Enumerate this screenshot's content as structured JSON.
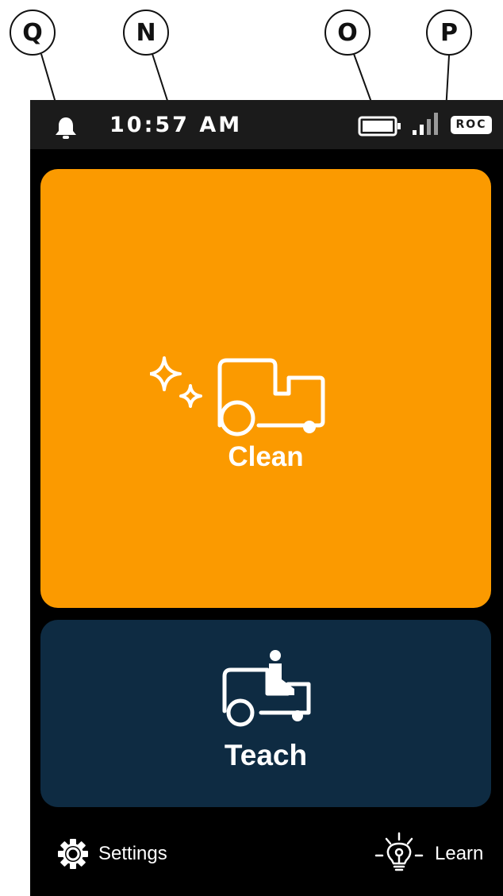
{
  "callouts": {
    "q": "Q",
    "n": "N",
    "o": "O",
    "p": "P"
  },
  "status_bar": {
    "time": "10:57 AM",
    "notification_icon": "bell-icon",
    "battery_icon": "battery-icon",
    "signal_icon": "signal-strength-icon",
    "badge": "ROC"
  },
  "tiles": {
    "clean": {
      "label": "Clean",
      "icon": "sparkle-scrubber-icon",
      "color": "#fb9a00"
    },
    "teach": {
      "label": "Teach",
      "icon": "scrubber-with-operator-icon",
      "color": "#0e2b42"
    }
  },
  "bottom_nav": {
    "settings": {
      "label": "Settings",
      "icon": "gear-icon"
    },
    "learn": {
      "label": "Learn",
      "icon": "lightbulb-icon"
    }
  }
}
